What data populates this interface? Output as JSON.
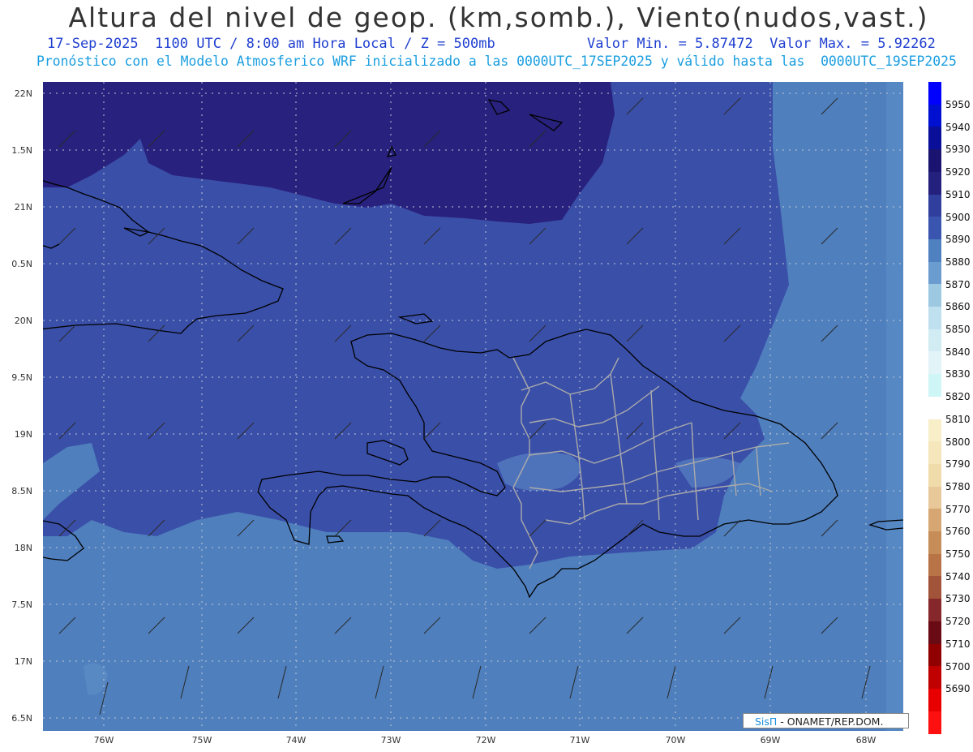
{
  "header": {
    "title": "Altura del nivel de geop. (km,somb.), Viento(nudos,vast.)",
    "subtitle_left": "17-Sep-2025  1100 UTC / 8:00 am Hora Local / Z = 500mb",
    "subtitle_right": "Valor Min. = 5.87472  Valor Max. = 5.92262",
    "subtitle2": "Pronóstico con el Modelo Atmosferico WRF inicializado a las 0000UTC_17SEP2025 y válido hasta las  0000UTC_19SEP2025"
  },
  "axes": {
    "lat_labels": [
      "22N",
      "1.5N",
      "21N",
      "0.5N",
      "20N",
      "9.5N",
      "19N",
      "8.5N",
      "18N",
      "7.5N",
      "17N",
      "6.5N"
    ],
    "lon_labels": [
      "76W",
      "75W",
      "74W",
      "73W",
      "72W",
      "71W",
      "70W",
      "69W",
      "68W"
    ]
  },
  "colorbar": {
    "levels": [
      "5950",
      "5940",
      "5930",
      "5920",
      "5910",
      "5900",
      "5890",
      "5880",
      "5870",
      "5860",
      "5850",
      "5840",
      "5830",
      "5820",
      "5810",
      "5800",
      "5790",
      "5780",
      "5770",
      "5760",
      "5750",
      "5740",
      "5730",
      "5720",
      "5710",
      "5700",
      "5690"
    ],
    "colors": [
      "#0000ff",
      "#0010d0",
      "#0a0f9a",
      "#1a1470",
      "#24207e",
      "#303e9e",
      "#3a55b0",
      "#4f80c0",
      "#6b9cd0",
      "#9cc8e2",
      "#bfe0ee",
      "#d2ecf4",
      "#e2f4f8",
      "#cef6f6",
      "#ffffff",
      "#f8eec8",
      "#f5e6bc",
      "#efdcaa",
      "#e8c898",
      "#d6a772",
      "#c78d58",
      "#b87346",
      "#a2543a",
      "#86282b",
      "#6a0a14",
      "#900000",
      "#c00000",
      "#e80000",
      "#ff1010"
    ]
  },
  "credit": {
    "brand": "SisΠ",
    "text": " - ONAMET/REP.DOM."
  },
  "map_colors": {
    "deep": "#28217d",
    "mid": "#3a4fa8",
    "light": "#4f7fbd",
    "lighter": "#6192c8"
  }
}
